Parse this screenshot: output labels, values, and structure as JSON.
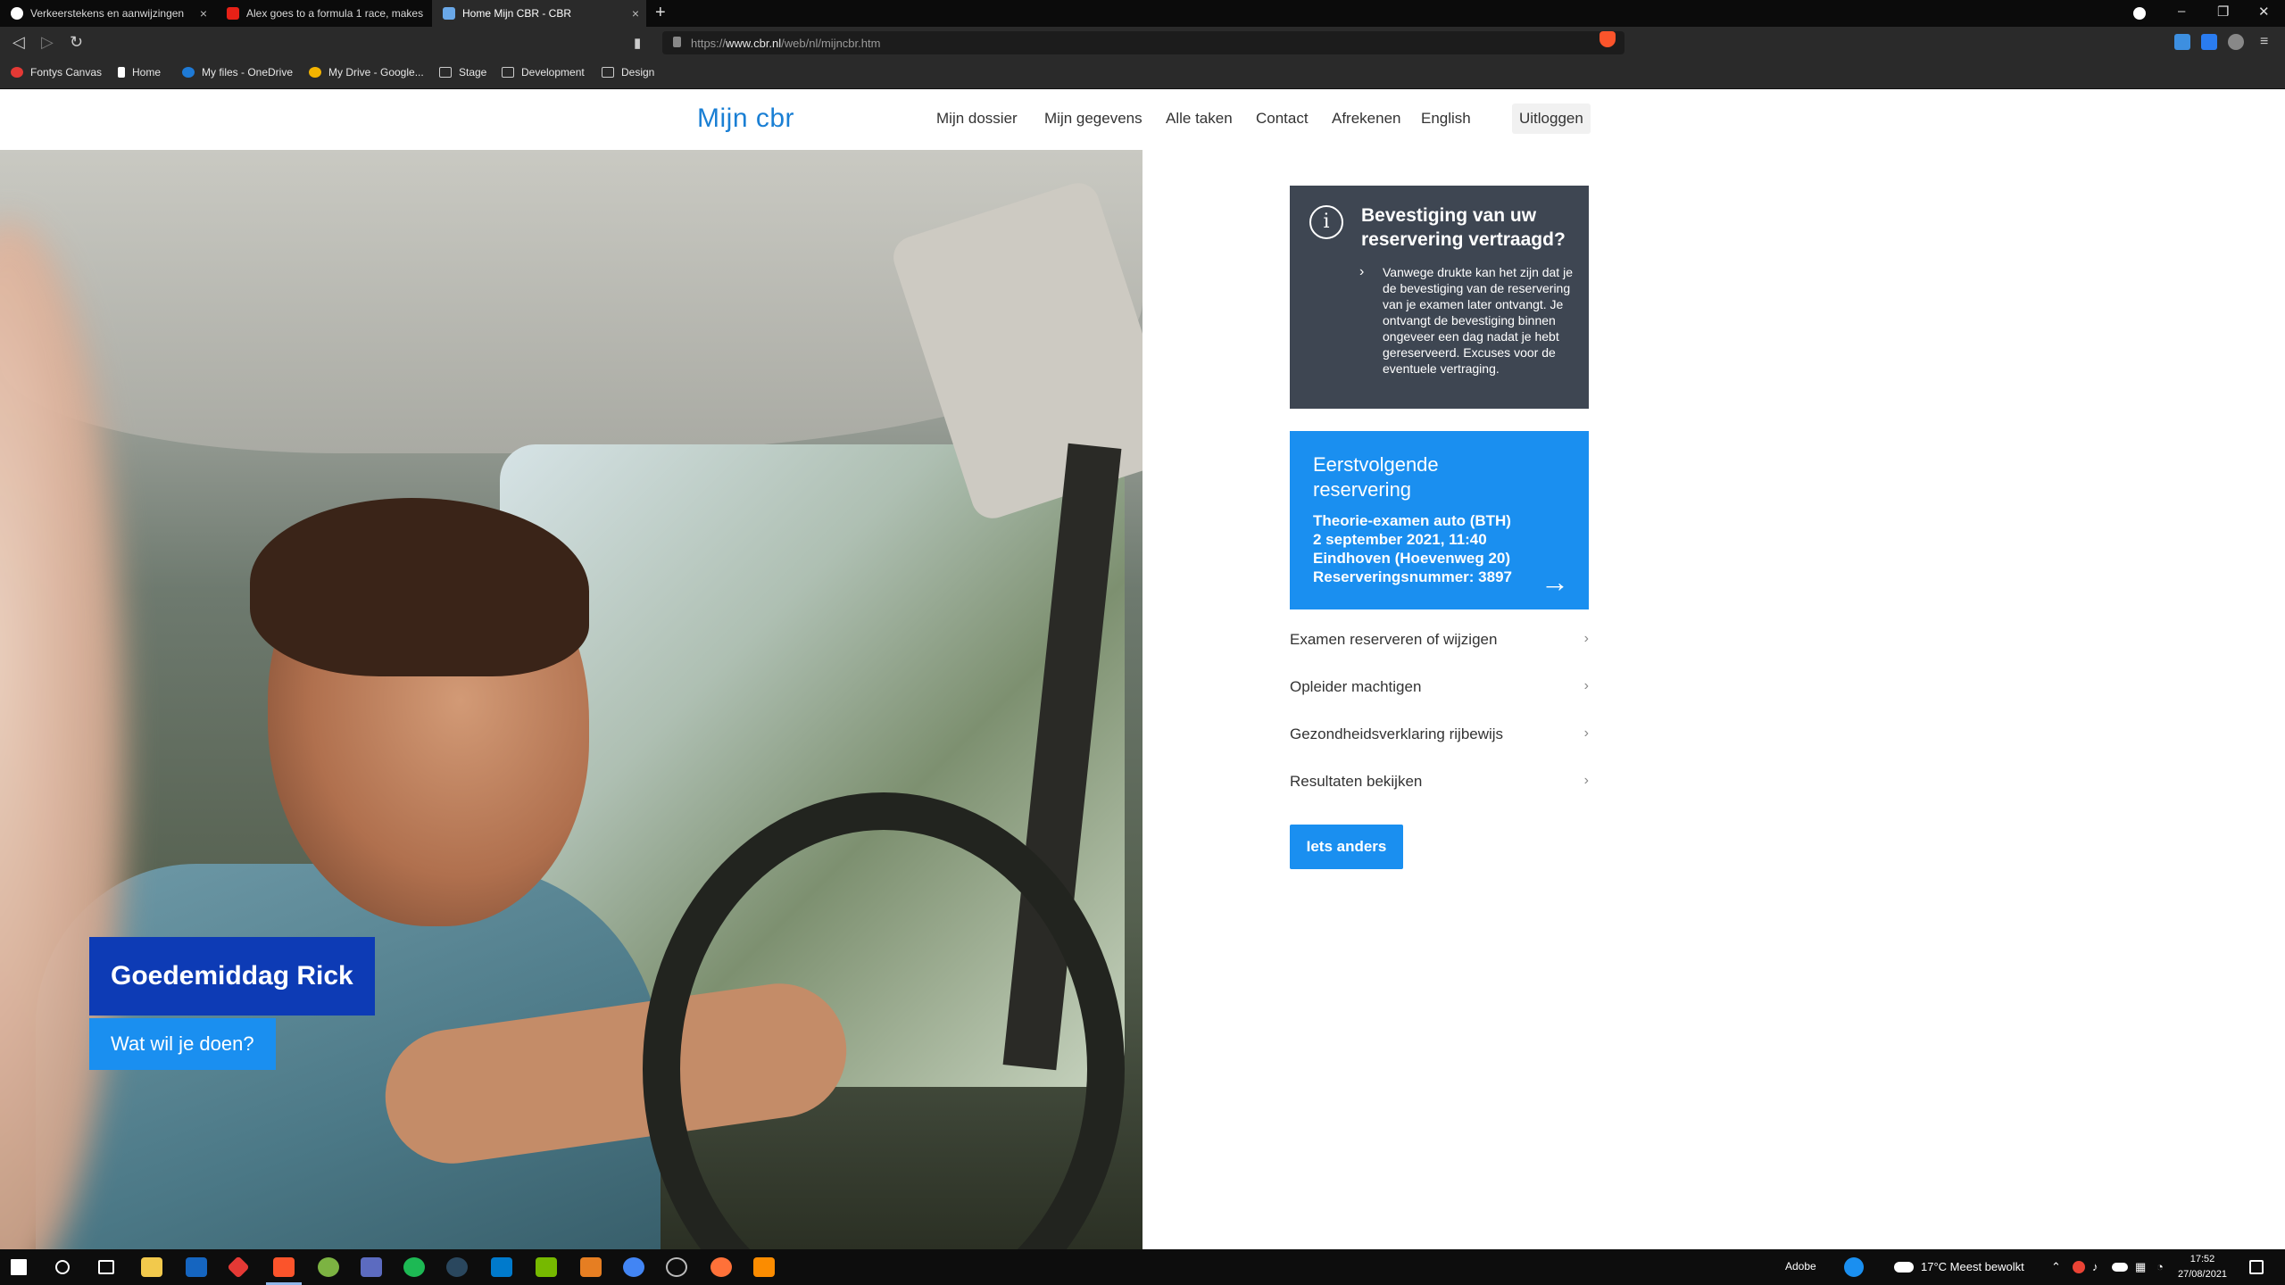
{
  "browser": {
    "tabs": [
      {
        "label": "Verkeerstekens en aanwijzingen",
        "active": false
      },
      {
        "label": "Alex goes to a formula 1 race, makes",
        "active": false
      },
      {
        "label": "Home Mijn CBR - CBR",
        "active": true
      }
    ],
    "new_tab": "+",
    "url_prefix": "https://",
    "url_domain": "www.cbr.nl",
    "url_path": "/web/nl/mijncbr.htm",
    "bookmarks": [
      "Fontys Canvas",
      "Home",
      "My files - OneDrive",
      "My Drive - Google...",
      "Stage",
      "Development",
      "Design"
    ]
  },
  "site": {
    "logo": "Mijn cbr",
    "nav": [
      "Mijn dossier",
      "Mijn gegevens",
      "Alle taken",
      "Contact",
      "Afrekenen",
      "English"
    ],
    "logout": "Uitloggen"
  },
  "hero": {
    "greeting": "Goedemiddag Rick",
    "subtitle": "Wat wil je doen?"
  },
  "notice": {
    "title": "Bevestiging van uw reservering vertraagd?",
    "body": "Vanwege drukte kan het zijn dat je de bevestiging van de reservering van je examen later ontvangt. Je ontvangt de bevestiging binnen ongeveer een dag nadat je hebt gereserveerd. Excuses voor de eventuele vertraging."
  },
  "reservation": {
    "title": "Eerstvolgende reservering",
    "lines": [
      "Theorie-examen auto (BTH)",
      "2 september 2021, 11:40",
      "Eindhoven (Hoevenweg 20)",
      "Reserveringsnummer: 3897"
    ]
  },
  "actions": [
    "Examen reserveren of wijzigen",
    "Opleider machtigen",
    "Gezondheidsverklaring rijbewijs",
    "Resultaten bekijken"
  ],
  "other_button": "Iets anders",
  "taskbar": {
    "tray_app": "Adobe",
    "weather": "17°C  Meest bewolkt",
    "time": "17:52",
    "date": "27/08/2021"
  },
  "colors": {
    "brand_blue": "#1a8ff0",
    "dark_blue": "#0d3bb5",
    "notice_bg": "#3e4652"
  }
}
